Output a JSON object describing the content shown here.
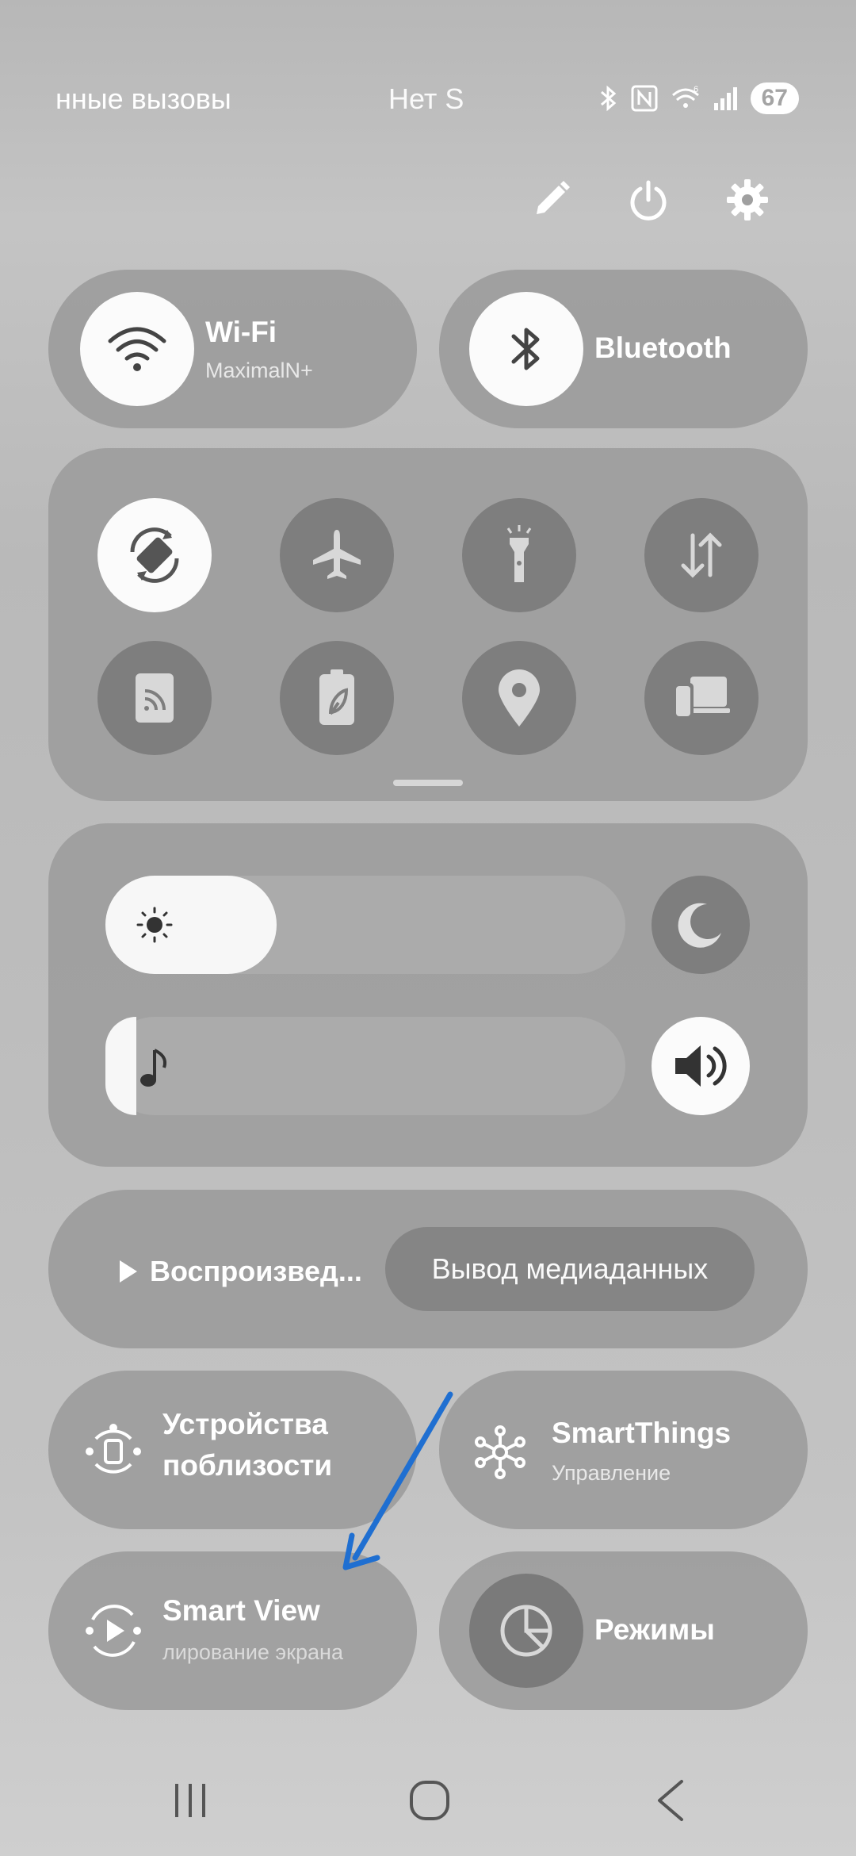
{
  "status_bar": {
    "left_text": "нные вызовы",
    "center_text": "Нет S",
    "battery": "67",
    "icons": [
      "bluetooth-icon",
      "nfc-icon",
      "wifi-6-icon",
      "signal-icon"
    ]
  },
  "top_actions": [
    "edit-icon",
    "power-icon",
    "settings-icon"
  ],
  "wifi": {
    "label": "Wi-Fi",
    "network": "MaximalN+"
  },
  "bluetooth": {
    "label": "Bluetooth"
  },
  "quick_toggles": [
    {
      "name": "auto-rotate",
      "active": true
    },
    {
      "name": "airplane-mode",
      "active": false
    },
    {
      "name": "flashlight",
      "active": false
    },
    {
      "name": "mobile-data",
      "active": false
    },
    {
      "name": "nfc-cast",
      "active": false
    },
    {
      "name": "power-saving",
      "active": false
    },
    {
      "name": "location",
      "active": false
    },
    {
      "name": "device-link",
      "active": false
    }
  ],
  "brightness": {
    "level": 0.33
  },
  "media_volume": {
    "level": 0.06
  },
  "media": {
    "play_label": "Воспроизвед...",
    "output_label": "Вывод медиаданных"
  },
  "nearby": {
    "label": "Устройства поблизости"
  },
  "smartthings": {
    "label": "SmartThings",
    "sub": "Управление"
  },
  "smartview": {
    "label": "Smart View",
    "sub": "лирование экрана"
  },
  "modes": {
    "label": "Режимы"
  },
  "colors": {
    "annotation_arrow": "#1f6fd1"
  }
}
